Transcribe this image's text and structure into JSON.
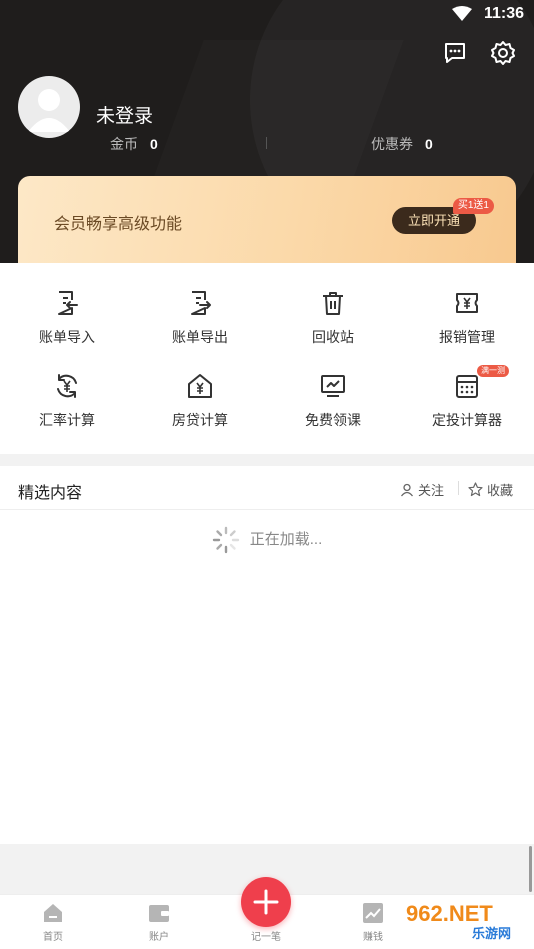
{
  "status": {
    "time": "11:36"
  },
  "profile": {
    "username": "未登录"
  },
  "stats": [
    {
      "label": "金币",
      "value": "0"
    },
    {
      "label": "优惠券",
      "value": "0"
    }
  ],
  "vip": {
    "title": "会员畅享高级功能",
    "button": "立即开通",
    "badge": "买1送1"
  },
  "tools": [
    {
      "label": "账单导入",
      "icon": "bill-import-icon"
    },
    {
      "label": "账单导出",
      "icon": "bill-export-icon"
    },
    {
      "label": "回收站",
      "icon": "trash-icon"
    },
    {
      "label": "报销管理",
      "icon": "reimburse-icon"
    },
    {
      "label": "汇率计算",
      "icon": "exchange-icon"
    },
    {
      "label": "房贷计算",
      "icon": "mortgage-icon"
    },
    {
      "label": "免费领课",
      "icon": "course-icon"
    },
    {
      "label": "定投计算器",
      "icon": "calculator-icon",
      "badge": "满一测"
    }
  ],
  "content": {
    "title": "精选内容",
    "follow": "关注",
    "favorite": "收藏",
    "loading": "正在加载..."
  },
  "tabs": [
    {
      "label": "首页"
    },
    {
      "label": "账户"
    },
    {
      "label": "记一笔"
    },
    {
      "label": "赚钱"
    }
  ],
  "watermark": {
    "text": "962.NET",
    "subtext": "乐游网"
  },
  "colors": {
    "accent": "#ef3f4c",
    "header_bg": "#1f1d1c",
    "vip_gold": "#fbd9a9"
  }
}
